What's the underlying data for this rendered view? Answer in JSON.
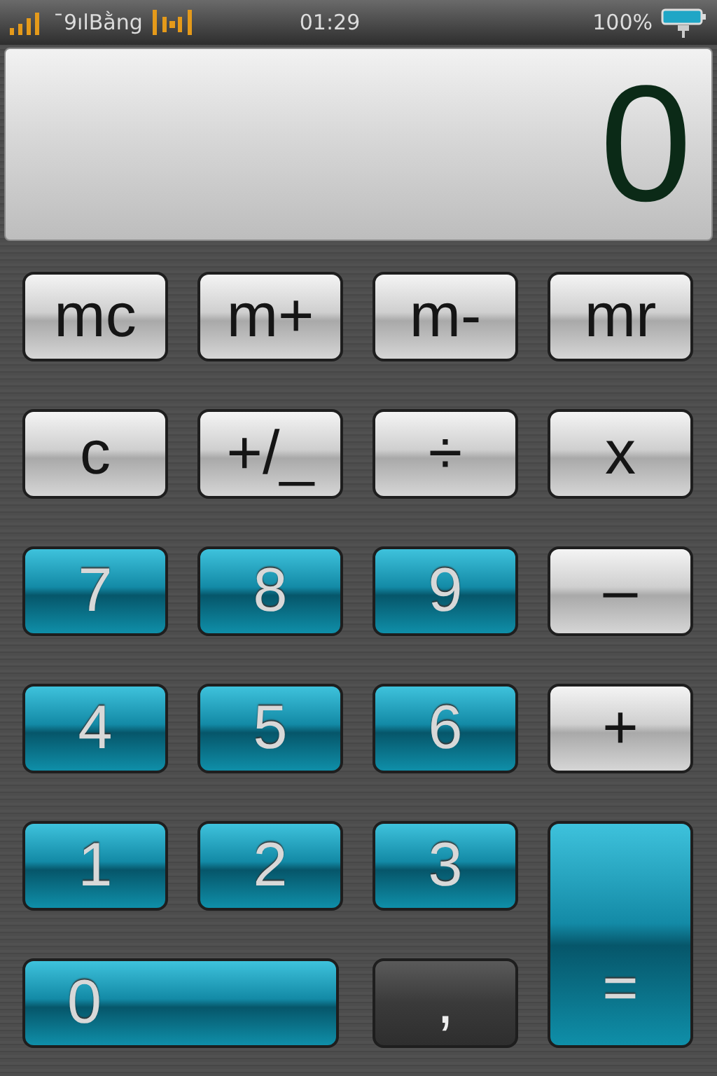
{
  "status_bar": {
    "carrier": "ˉ9ılBằng",
    "time": "01:29",
    "battery": "100%"
  },
  "display": {
    "value": "0"
  },
  "keys": [
    {
      "label": "mc",
      "kind": "grey",
      "wide": false,
      "tall": false
    },
    {
      "label": "m+",
      "kind": "grey",
      "wide": false,
      "tall": false
    },
    {
      "label": "m-",
      "kind": "grey",
      "wide": false,
      "tall": false
    },
    {
      "label": "mr",
      "kind": "grey",
      "wide": false,
      "tall": false
    },
    {
      "label": "c",
      "kind": "grey",
      "wide": false,
      "tall": false
    },
    {
      "label": "+/_",
      "kind": "grey",
      "wide": false,
      "tall": false
    },
    {
      "label": "÷",
      "kind": "grey",
      "wide": false,
      "tall": false
    },
    {
      "label": "x",
      "kind": "grey",
      "wide": false,
      "tall": false
    },
    {
      "label": "7",
      "kind": "blue",
      "wide": false,
      "tall": false
    },
    {
      "label": "8",
      "kind": "blue",
      "wide": false,
      "tall": false
    },
    {
      "label": "9",
      "kind": "blue",
      "wide": false,
      "tall": false
    },
    {
      "label": "–",
      "kind": "grey",
      "wide": false,
      "tall": false
    },
    {
      "label": "4",
      "kind": "blue",
      "wide": false,
      "tall": false
    },
    {
      "label": "5",
      "kind": "blue",
      "wide": false,
      "tall": false
    },
    {
      "label": "6",
      "kind": "blue",
      "wide": false,
      "tall": false
    },
    {
      "label": "+",
      "kind": "grey",
      "wide": false,
      "tall": false
    },
    {
      "label": "1",
      "kind": "blue",
      "wide": false,
      "tall": false
    },
    {
      "label": "2",
      "kind": "blue",
      "wide": false,
      "tall": false
    },
    {
      "label": "3",
      "kind": "blue",
      "wide": false,
      "tall": false
    },
    {
      "label": "0",
      "kind": "blue",
      "wide": true,
      "tall": false
    },
    {
      "label": ",",
      "kind": "dark",
      "wide": false,
      "tall": false
    },
    {
      "label": "=",
      "kind": "blue",
      "wide": false,
      "tall": true
    }
  ]
}
